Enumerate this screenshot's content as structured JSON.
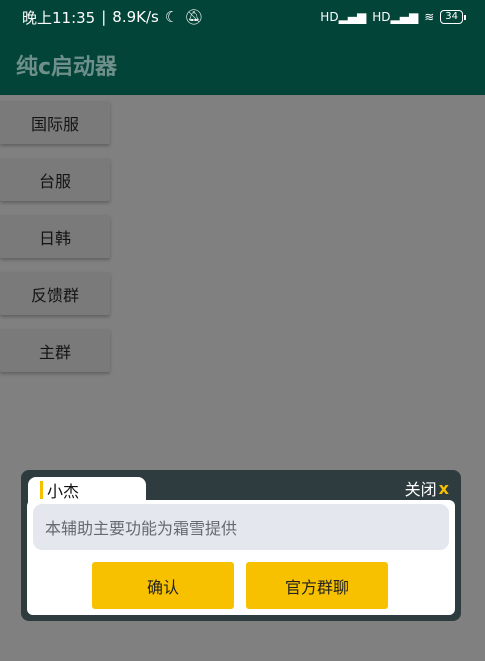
{
  "status_bar": {
    "time": "晚上11:35",
    "speed": "8.9K/s",
    "signal_1": "HD",
    "signal_2": "HD",
    "battery": "34"
  },
  "app": {
    "title": "纯c启动器"
  },
  "side_buttons": [
    {
      "label": "国际服"
    },
    {
      "label": "台服"
    },
    {
      "label": "日韩"
    },
    {
      "label": "反馈群"
    },
    {
      "label": "主群"
    }
  ],
  "dialog": {
    "tab_label": "小杰",
    "close_label": "关闭",
    "close_icon": "x",
    "message": "本辅助主要功能为霜雪提供",
    "confirm_label": "确认",
    "group_label": "官方群聊"
  },
  "colors": {
    "appbar": "#034439",
    "overlay": "#808080",
    "accent": "#f7c100",
    "dialog_frame": "#2e3b3f"
  }
}
